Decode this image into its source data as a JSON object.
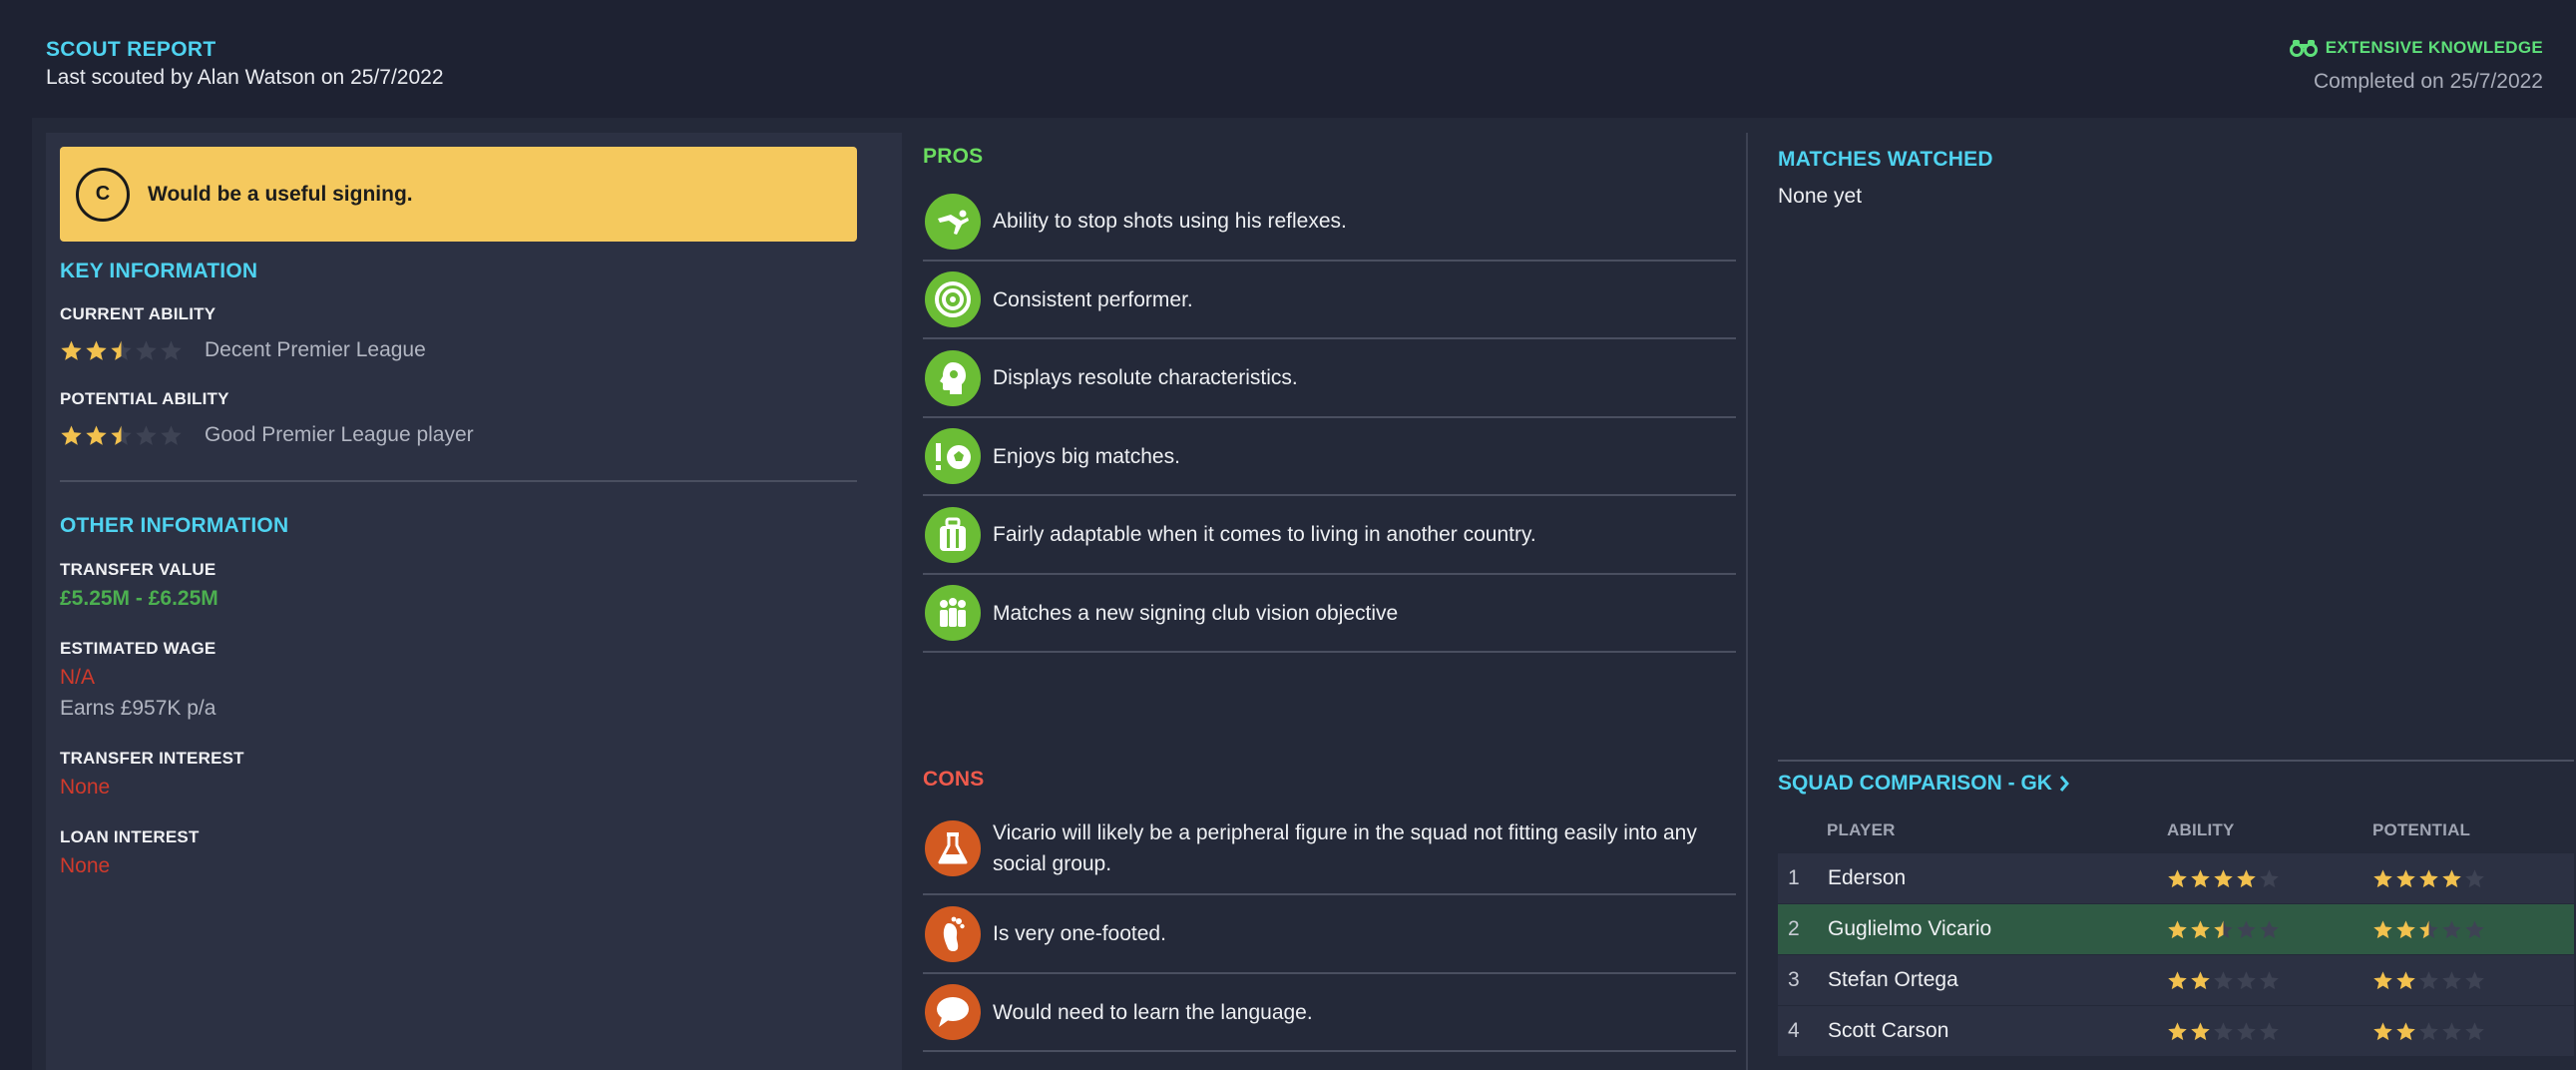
{
  "header": {
    "title": "SCOUT REPORT",
    "subtitle": "Last scouted by Alan Watson on 25/7/2022",
    "knowledge": "EXTENSIVE KNOWLEDGE",
    "completed": "Completed on 25/7/2022",
    "knowledge_icon": "binoculars-icon",
    "accent": "#4fd3f0"
  },
  "verdict": {
    "grade": "C",
    "text": "Would be a useful signing.",
    "color": "#f5c95e"
  },
  "key_info": {
    "title": "KEY INFORMATION",
    "current_ability": {
      "label": "CURRENT ABILITY",
      "stars": 2.5,
      "max": 5,
      "text": "Decent Premier League"
    },
    "potential_ability": {
      "label": "POTENTIAL ABILITY",
      "stars": 2.5,
      "max": 5,
      "text": "Good Premier League player"
    }
  },
  "other_info": {
    "title": "OTHER INFORMATION",
    "transfer_value": {
      "label": "TRANSFER VALUE",
      "value": "£5.25M - £6.25M",
      "color": "#4caf50"
    },
    "estimated_wage": {
      "label": "ESTIMATED WAGE",
      "value": "N/A",
      "note": "Earns £957K p/a",
      "color": "#d03a2c"
    },
    "transfer_interest": {
      "label": "TRANSFER INTEREST",
      "value": "None",
      "color": "#d03a2c"
    },
    "loan_interest": {
      "label": "LOAN INTEREST",
      "value": "None",
      "color": "#d03a2c"
    }
  },
  "pros": {
    "title": "PROS",
    "color": "#6bdd5f",
    "items": [
      {
        "text": "Ability to stop shots using his reflexes.",
        "icon": "diving-keeper-icon"
      },
      {
        "text": "Consistent performer.",
        "icon": "target-icon"
      },
      {
        "text": "Displays resolute characteristics.",
        "icon": "head-profile-icon"
      },
      {
        "text": "Enjoys big matches.",
        "icon": "exclamation-football-icon"
      },
      {
        "text": "Fairly adaptable when it comes to living in another country.",
        "icon": "suitcase-icon"
      },
      {
        "text": "Matches a new signing club vision objective",
        "icon": "group-icon"
      }
    ]
  },
  "cons": {
    "title": "CONS",
    "color": "#ef5a4c",
    "items": [
      {
        "text": "Vicario will likely be a peripheral figure in the squad not fitting easily into any social group.",
        "icon": "flask-icon"
      },
      {
        "text": "Is very one-footed.",
        "icon": "foot-icon"
      },
      {
        "text": "Would need to learn the language.",
        "icon": "speech-bubble-icon"
      }
    ]
  },
  "matches": {
    "title": "MATCHES WATCHED",
    "text": "None yet"
  },
  "squad": {
    "title": "SQUAD COMPARISON - GK",
    "headers": {
      "player": "PLAYER",
      "ability": "ABILITY",
      "potential": "POTENTIAL"
    },
    "rows": [
      {
        "num": "1",
        "name": "Ederson",
        "ability": 4,
        "potential": 4,
        "highlight": false
      },
      {
        "num": "2",
        "name": "Guglielmo Vicario",
        "ability": 2.5,
        "potential": 2.5,
        "highlight": true
      },
      {
        "num": "3",
        "name": "Stefan Ortega",
        "ability": 2,
        "potential": 2,
        "highlight": false
      },
      {
        "num": "4",
        "name": "Scott Carson",
        "ability": 2,
        "potential": 2,
        "highlight": false
      }
    ]
  }
}
